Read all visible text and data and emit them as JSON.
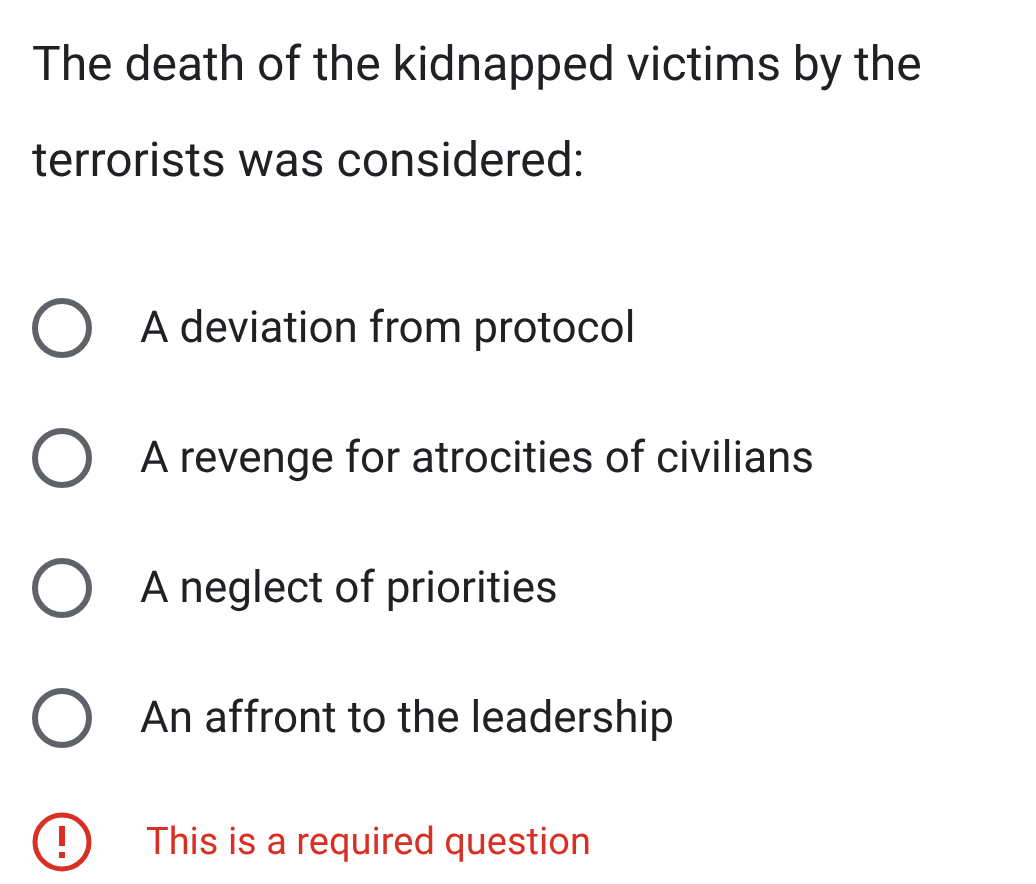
{
  "question": {
    "text": "The death of the kidnapped victims by the terrorists was considered:"
  },
  "options": [
    {
      "label": "A deviation from protocol",
      "selected": false
    },
    {
      "label": "A revenge for atrocities of civilians",
      "selected": false
    },
    {
      "label": "A neglect of priorities",
      "selected": false
    },
    {
      "label": "An affront to the leadership",
      "selected": false
    }
  ],
  "error": {
    "text": "This is a required question"
  }
}
